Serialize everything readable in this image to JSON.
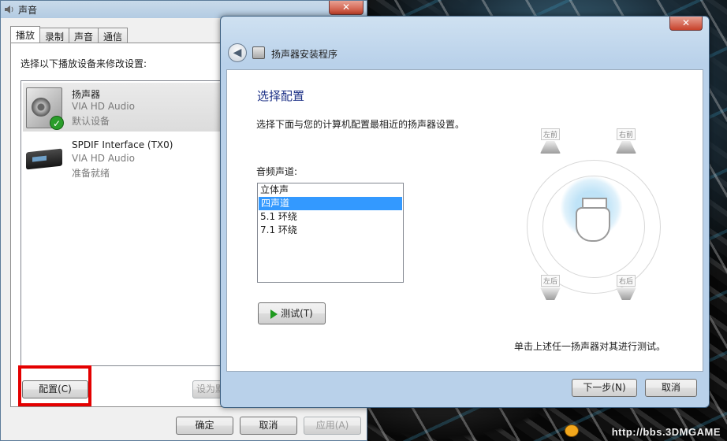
{
  "sound": {
    "title": "声音",
    "close": "✕",
    "tabs": [
      "播放",
      "录制",
      "声音",
      "通信"
    ],
    "instruction": "选择以下播放设备来修改设置:",
    "devices": [
      {
        "name": "扬声器",
        "driver": "VIA HD Audio",
        "status": "默认设备"
      },
      {
        "name": "SPDIF Interface (TX0)",
        "driver": "VIA HD Audio",
        "status": "准备就绪"
      }
    ],
    "configure": "配置(C)",
    "set_default": "设为默认值(S)",
    "ok": "确定",
    "cancel": "取消",
    "apply": "应用(A)"
  },
  "setup": {
    "title": "扬声器安装程序",
    "close": "✕",
    "heading": "选择配置",
    "description": "选择下面与您的计算机配置最相近的扬声器设置。",
    "channel_label": "音频声道:",
    "channels": [
      "立体声",
      "四声道",
      "5.1 环绕",
      "7.1 环绕"
    ],
    "selected_channel": "四声道",
    "test": "测试(T)",
    "hint": "单击上述任一扬声器对其进行测试。",
    "speakers": {
      "fl": "左前",
      "fr": "右前",
      "rl": "左后",
      "rr": "右后"
    },
    "next": "下一步(N)",
    "cancel": "取消"
  },
  "watermark": "http://bbs.3DMGAME"
}
